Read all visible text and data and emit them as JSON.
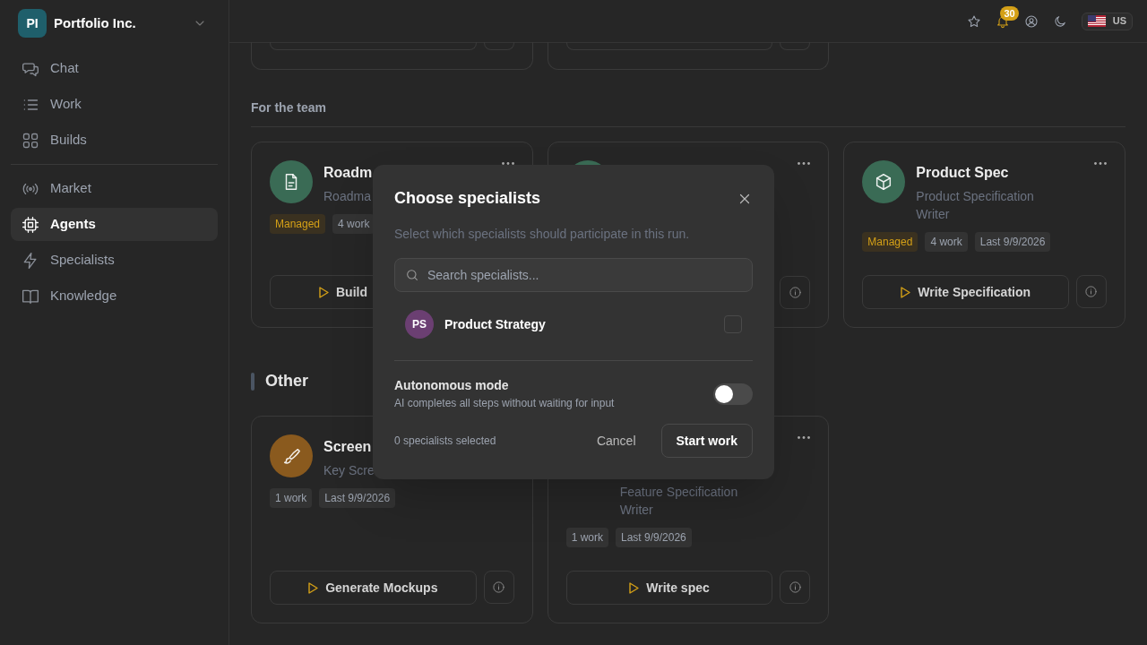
{
  "workspace": {
    "initials": "PI",
    "name": "Portfolio Inc."
  },
  "sidebar": {
    "groups": [
      {
        "items": [
          {
            "label": "Chat",
            "selected": false
          },
          {
            "label": "Work",
            "selected": false
          },
          {
            "label": "Builds",
            "selected": false
          }
        ]
      },
      {
        "items": [
          {
            "label": "Market",
            "selected": false
          },
          {
            "label": "Agents",
            "selected": true
          },
          {
            "label": "Specialists",
            "selected": false
          },
          {
            "label": "Knowledge",
            "selected": false
          }
        ]
      }
    ]
  },
  "header": {
    "notification_count": "30",
    "region": "US"
  },
  "sections": [
    {
      "kind": "cut",
      "cards": [
        {
          "info": true
        },
        {
          "info": true
        }
      ]
    },
    {
      "kind": "subheading",
      "title": "For the team",
      "cards": [
        {
          "color": "#3a6b55",
          "title": "Roadm",
          "subtitle": "Roadma",
          "tags": [
            {
              "label": "Managed",
              "kind": "managed"
            },
            {
              "label": "4 work",
              "kind": "plain"
            }
          ],
          "action": "Build",
          "info": false
        },
        {
          "color": "#3a6b55",
          "info": true
        },
        {
          "color": "#3a6b55",
          "title": "Product Spec",
          "subtitle": "Product Specification Writer",
          "tags": [
            {
              "label": "Managed",
              "kind": "managed"
            },
            {
              "label": "4 work",
              "kind": "plain"
            },
            {
              "label": "Last 9/9/2026",
              "kind": "plain"
            }
          ],
          "action": "Write Specification",
          "info": true
        }
      ]
    },
    {
      "kind": "heading",
      "title": "Other",
      "cards": [
        {
          "color": "#8a5a1e",
          "title": "Screen",
          "subtitle": "Key Scre",
          "tags": [
            {
              "label": "1 work",
              "kind": "plain"
            },
            {
              "label": "Last 9/9/2026",
              "kind": "plain"
            }
          ],
          "action": "Generate Mockups",
          "info": true
        },
        {
          "subtitle": "Feature Specification Writer",
          "tags": [
            {
              "label": "1 work",
              "kind": "plain"
            },
            {
              "label": "Last 9/9/2026",
              "kind": "plain"
            }
          ],
          "action": "Write spec",
          "info": true
        }
      ]
    }
  ],
  "dialog": {
    "title": "Choose specialists",
    "description": "Select which specialists should participate in this run.",
    "search": {
      "placeholder": "Search specialists..."
    },
    "specialists": [
      {
        "initials": "PS",
        "name": "Product Strategy",
        "color": "#6b3f72",
        "checked": false
      }
    ],
    "autonomous": {
      "label": "Autonomous mode",
      "description": "AI completes all steps without waiting for input",
      "on": false
    },
    "selected_count": "0 specialists selected",
    "buttons": [
      "Cancel",
      "Start work"
    ]
  }
}
